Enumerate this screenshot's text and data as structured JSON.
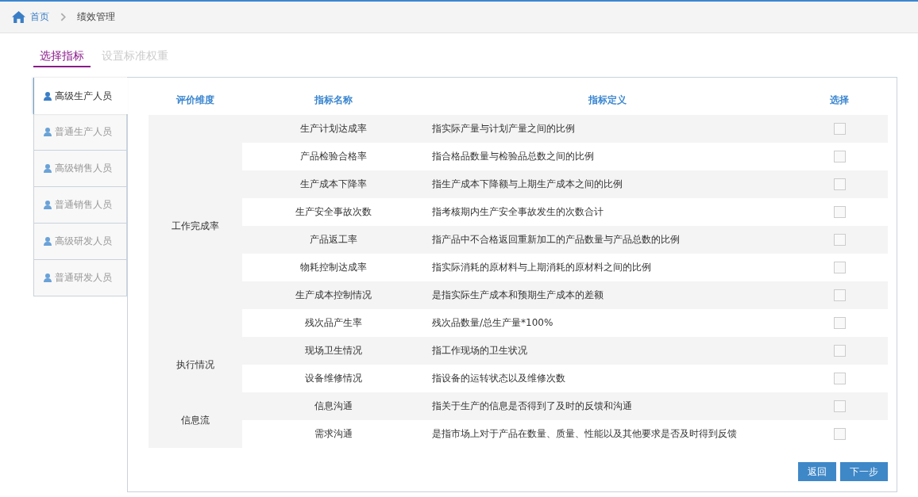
{
  "breadcrumb": {
    "home": "首页",
    "current": "绩效管理"
  },
  "tabs": [
    {
      "label": "选择指标",
      "selected": true
    },
    {
      "label": "设置标准权重",
      "selected": false
    }
  ],
  "sidebar": {
    "items": [
      {
        "label": "高级生产人员",
        "selected": true
      },
      {
        "label": "普通生产人员",
        "selected": false
      },
      {
        "label": "高级销售人员",
        "selected": false
      },
      {
        "label": "普通销售人员",
        "selected": false
      },
      {
        "label": "高级研发人员",
        "selected": false
      },
      {
        "label": "普通研发人员",
        "selected": false
      }
    ]
  },
  "table": {
    "columns": [
      "评价维度",
      "指标名称",
      "指标定义",
      "选择"
    ],
    "groups": [
      {
        "name": "工作完成率",
        "rows": [
          {
            "name": "生产计划达成率",
            "definition": "指实际产量与计划产量之间的比例",
            "checked": false
          },
          {
            "name": "产品检验合格率",
            "definition": "指合格品数量与检验品总数之间的比例",
            "checked": false
          },
          {
            "name": "生产成本下降率",
            "definition": "指生产成本下降额与上期生产成本之间的比例",
            "checked": false
          },
          {
            "name": "生产安全事故次数",
            "definition": "指考核期内生产安全事故发生的次数合计",
            "checked": false
          },
          {
            "name": "产品返工率",
            "definition": "指产品中不合格返回重新加工的产品数量与产品总数的比例",
            "checked": false
          },
          {
            "name": "物耗控制达成率",
            "definition": "指实际消耗的原材料与上期消耗的原材料之间的比例",
            "checked": false
          },
          {
            "name": "生产成本控制情况",
            "definition": "是指实际生产成本和预期生产成本的差额",
            "checked": false
          },
          {
            "name": "残次品产生率",
            "definition": "残次品数量/总生产量*100%",
            "checked": false
          }
        ]
      },
      {
        "name": "执行情况",
        "rows": [
          {
            "name": "现场卫生情况",
            "definition": "指工作现场的卫生状况",
            "checked": false
          },
          {
            "name": "设备维修情况",
            "definition": "指设备的运转状态以及维修次数",
            "checked": false
          }
        ]
      },
      {
        "name": "信息流",
        "rows": [
          {
            "name": "信息沟通",
            "definition": "指关于生产的信息是否得到了及时的反馈和沟通",
            "checked": false
          },
          {
            "name": "需求沟通",
            "definition": "是指市场上对于产品在数量、质量、性能以及其他要求是否及时得到反馈",
            "checked": false
          }
        ]
      }
    ]
  },
  "buttons": [
    {
      "label": "返回"
    },
    {
      "label": "下一步"
    }
  ]
}
